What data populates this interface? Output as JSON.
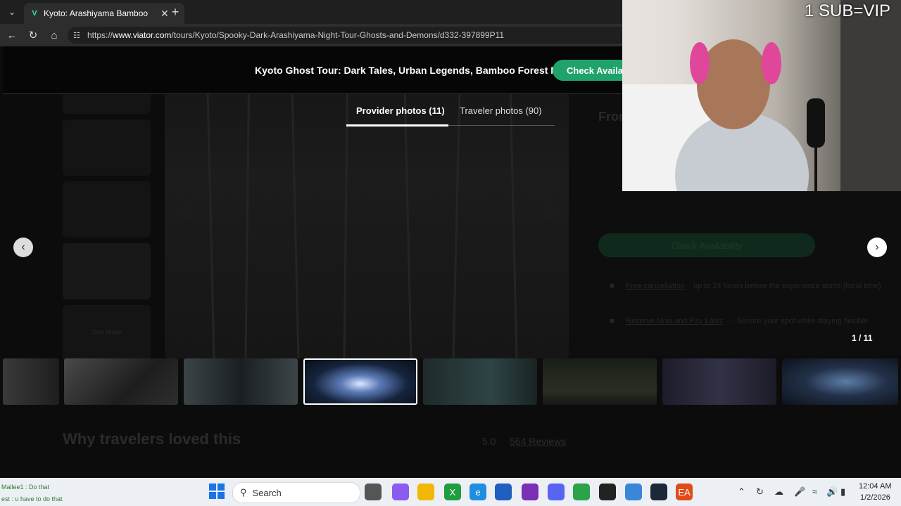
{
  "browser": {
    "tab_title": "Kyoto: Arashiyama Bamboo Forest",
    "url_prefix": "https://",
    "url_domain": "www.viator.com",
    "url_path": "/tours/Kyoto/Spooky-Dark-Arashiyama-Night-Tour-Ghosts-and-Demons/d332-397899P11"
  },
  "page": {
    "tour_title": "Kyoto Ghost Tour: Dark Tales, Urban Legends, Bamboo Forest Night",
    "check_availability": "Check Availabi",
    "tabs": [
      {
        "label": "Provider photos (11)"
      },
      {
        "label": "Traveler photos (90)"
      }
    ],
    "counter": "1 / 11",
    "see_more": "See More",
    "why_travelers": "Why travelers loved this",
    "rating": "5.0",
    "reviews": "564 Reviews",
    "from_label": "From",
    "check_availability_dim": "Check Availability",
    "free_cancellation": "Free cancellation",
    "free_cancellation_desc": "up to 24 hours before the experience starts (local time)",
    "reserve_now": "Reserve Now and Pay Later",
    "reserve_now_desc": "- Secure your spot while staying flexible"
  },
  "stream": {
    "sub_text": "1 SUB=VIP",
    "chat_line1": "Mallee1 : Do that",
    "chat_line2": "est : u have to do that"
  },
  "taskbar": {
    "search_label": "Search",
    "time": "12:04 AM",
    "date": "1/2/2026"
  },
  "colors": {
    "accent_green": "#1fa36a",
    "taskbar_bg": "#eceff3"
  }
}
